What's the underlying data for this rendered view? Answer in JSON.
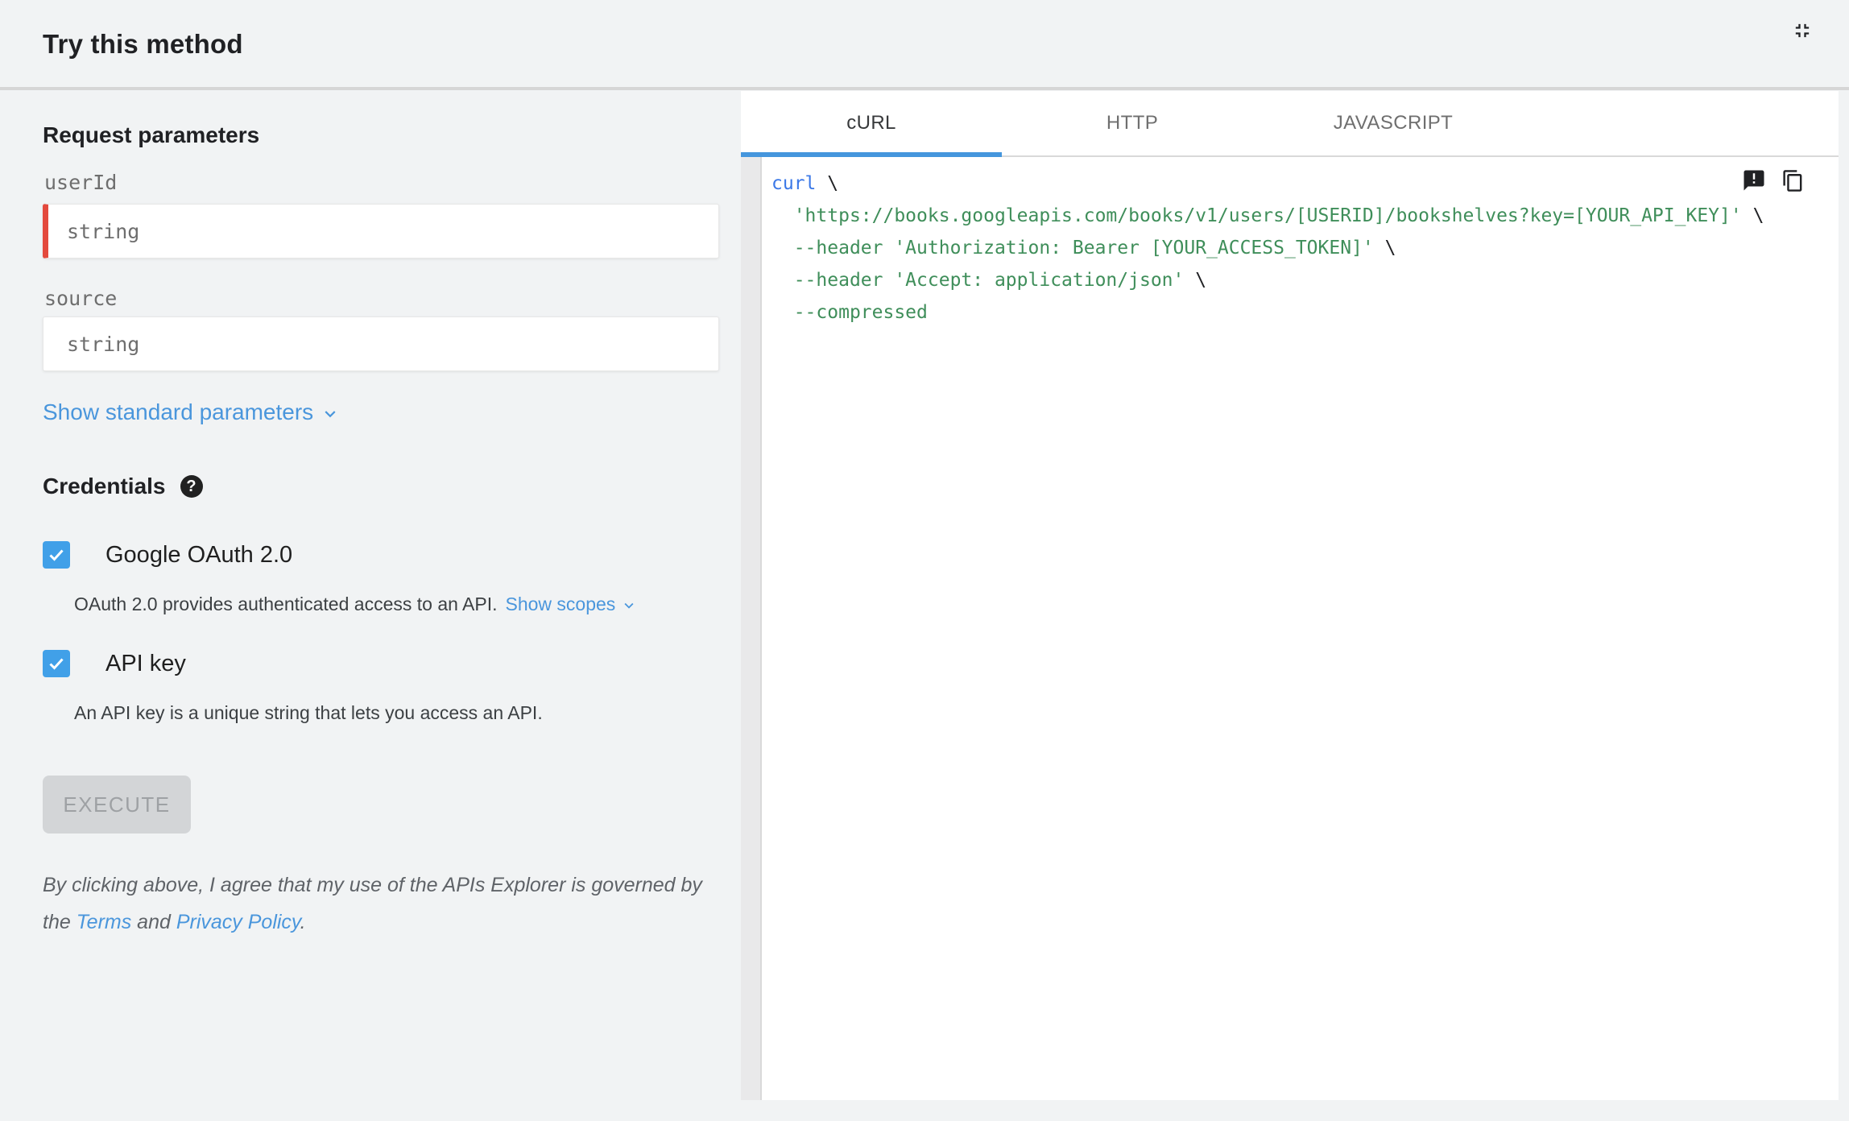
{
  "header": {
    "title": "Try this method",
    "collapse_icon": "fullscreen-exit-icon"
  },
  "request_parameters": {
    "heading": "Request parameters",
    "fields": [
      {
        "name": "userId",
        "placeholder": "string",
        "required": true
      },
      {
        "name": "source",
        "placeholder": "string",
        "required": false
      }
    ],
    "show_standard_label": "Show standard parameters"
  },
  "credentials": {
    "heading": "Credentials",
    "help_glyph": "?",
    "options": [
      {
        "label": "Google OAuth 2.0",
        "checked": true,
        "description": "OAuth 2.0 provides authenticated access to an API.",
        "link_label": "Show scopes"
      },
      {
        "label": "API key",
        "checked": true,
        "description": "An API key is a unique string that lets you access an API.",
        "link_label": ""
      }
    ]
  },
  "execute": {
    "label": "EXECUTE",
    "enabled": false
  },
  "legal": {
    "line1": "By clicking above, I agree that my use of the APIs Explorer is governed by",
    "line2_prefix": "the ",
    "terms_link": "Terms",
    "line2_middle": " and ",
    "privacy_link": "Privacy Policy",
    "line2_suffix": "."
  },
  "code_panel": {
    "tabs": [
      {
        "label": "cURL",
        "active": true
      },
      {
        "label": "HTTP",
        "active": false
      },
      {
        "label": "JAVASCRIPT",
        "active": false
      }
    ],
    "icons": [
      "feedback-icon",
      "copy-icon"
    ],
    "code": {
      "language": "curl",
      "lines": [
        [
          {
            "type": "keyword",
            "text": "curl"
          },
          {
            "type": "plain",
            "text": " \\"
          }
        ],
        [
          {
            "type": "plain",
            "text": "  "
          },
          {
            "type": "string",
            "text": "'https://books.googleapis.com/books/v1/users/[USERID]/bookshelves?key=[YOUR_API_KEY]'"
          },
          {
            "type": "plain",
            "text": " \\"
          }
        ],
        [
          {
            "type": "plain",
            "text": "  "
          },
          {
            "type": "string",
            "text": "--header 'Authorization: Bearer [YOUR_ACCESS_TOKEN]'"
          },
          {
            "type": "plain",
            "text": " \\"
          }
        ],
        [
          {
            "type": "plain",
            "text": "  "
          },
          {
            "type": "string",
            "text": "--header 'Accept: application/json'"
          },
          {
            "type": "plain",
            "text": " \\"
          }
        ],
        [
          {
            "type": "plain",
            "text": "  "
          },
          {
            "type": "string",
            "text": "--compressed"
          }
        ]
      ]
    }
  },
  "colors": {
    "page_bg": "#f1f3f4",
    "panel_bg": "#ffffff",
    "accent_blue_link": "#4a96dc",
    "accent_blue_tab": "#4596dd",
    "checkbox_blue": "#41a0e8",
    "required_red": "#e3493d",
    "code_keyword_blue": "#3b78e7",
    "code_string_green": "#3f8e5a",
    "disabled_button_bg": "#d3d5d7",
    "disabled_button_text": "#9ea1a4"
  }
}
